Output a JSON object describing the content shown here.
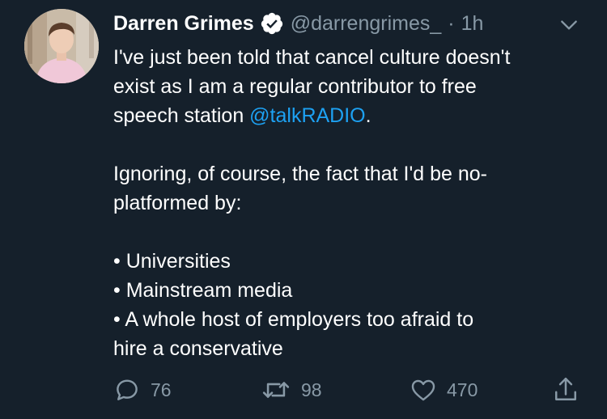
{
  "tweet": {
    "author_name": "Darren Grimes",
    "handle": "@darrengrimes_",
    "separator": "·",
    "time": "1h",
    "verified": true,
    "text": {
      "line1": "I've just been told that cancel culture doesn't",
      "line2": "exist as I am a regular contributor to free",
      "line3_before": "speech station ",
      "line3_mention": "@talkRADIO",
      "line3_after": ".",
      "line4": "Ignoring, of course, the fact that I'd be no-",
      "line5": "platformed by:",
      "bullet1": "• Universities",
      "bullet2": "• Mainstream media",
      "bullet3": "• A whole host of employers too afraid to",
      "bullet3_cont": "hire a conservative"
    },
    "actions": {
      "reply_count": "76",
      "retweet_count": "98",
      "like_count": "470"
    }
  },
  "colors": {
    "background": "#15202b",
    "text_primary": "#ffffff",
    "text_secondary": "#8899a6",
    "link": "#1da1f2"
  },
  "icons": {
    "avatar": "profile-photo",
    "verified": "verified-badge-icon",
    "caret": "chevron-down-icon",
    "reply": "reply-bubble-icon",
    "retweet": "retweet-icon",
    "like": "heart-icon",
    "share": "share-icon"
  }
}
